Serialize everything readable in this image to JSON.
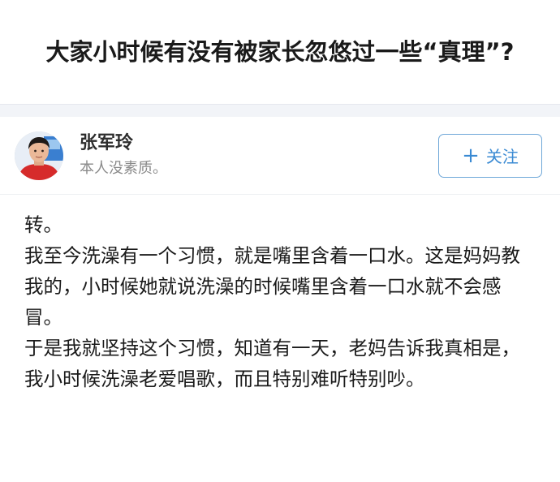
{
  "question": {
    "title": "大家小时候有没有被家长忽悠过一些“真理”?"
  },
  "author": {
    "name": "张军玲",
    "bio": "本人没素质。",
    "avatar_icon": "user-avatar-photo"
  },
  "follow": {
    "label": "关注",
    "icon": "plus-icon",
    "color": "#3a8ad3"
  },
  "answer": {
    "paragraphs": [
      "转。",
      "我至今洗澡有一个习惯，就是嘴里含着一口水。这是妈妈教我的，小时候她就说洗澡的时候嘴里含着一口水就不会感冒。",
      "于是我就坚持这个习惯，知道有一天，老妈告诉我真相是，我小时候洗澡老爱唱歌，而且特别难听特别吵。"
    ]
  }
}
